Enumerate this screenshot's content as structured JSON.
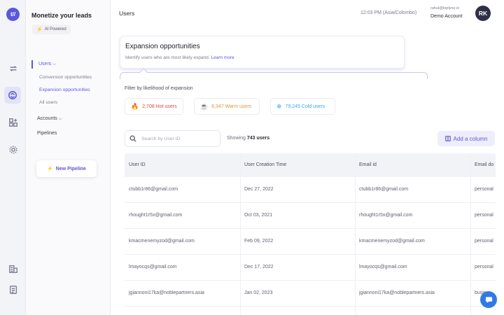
{
  "sidebar": {
    "title": "Monetize your leads",
    "ai_badge": "AI Powered",
    "nav": {
      "users": "Users",
      "conversion": "Conversion opportunities",
      "expansion": "Expansion opportunities",
      "all_users": "All users",
      "accounts": "Accounts",
      "pipelines": "Pipelines"
    },
    "new_pipeline": "New Pipeline"
  },
  "header": {
    "title": "Users",
    "time": "12:03 PM (Asia/Colombo)",
    "account_email": "rahul@toplyne.io",
    "account_name": "Demo Account",
    "avatar_initials": "RK"
  },
  "card": {
    "title": "Expansion opportunities",
    "description": "Identify users who are most likely expand.",
    "learn_more": "Learn more"
  },
  "filters": {
    "label": "Filter by likelihood of expansion",
    "hot": "2,708 Hot users",
    "warm": "6,347 Warm users",
    "cold": "79,245 Cold users"
  },
  "toolbar": {
    "search_placeholder": "Search by User ID",
    "showing_prefix": "Showing",
    "showing_count": "743",
    "showing_suffix": "users",
    "add_column": "Add a column"
  },
  "table": {
    "headers": [
      "User ID",
      "User Creation Time",
      "Email id",
      "Email do"
    ],
    "rows": [
      [
        "ctubb1r86@gmail.com",
        "Dec 27, 2022",
        "ctubb1r86@gmail.com",
        "personal"
      ],
      [
        "rhought1r5x@gmail.com",
        "Oct 03, 2021",
        "rhought1r5x@gmail.com",
        "personal"
      ],
      [
        "kmacmenemyzod@gmail.com",
        "Feb 09, 2022",
        "kmacmenemyzod@gmail.com",
        "personal"
      ],
      [
        "lmayocqs@gmail.com",
        "Dec 17, 2022",
        "lmayocqs@gmail.com",
        "personal"
      ],
      [
        "jgiannoni17ka@noblepartners.asia",
        "Jan 02, 2023",
        "jgiannoni17ka@noblepartners.asia",
        "busin"
      ]
    ]
  },
  "colors": {
    "accent": "#5b57d9",
    "hot": "#e24848",
    "warm": "#e8923a",
    "cold": "#3aa7e8"
  },
  "icons": {
    "rail": [
      "logo-icon",
      "sync-icon",
      "expansion-icon",
      "apps-icon",
      "gear-icon",
      "building-icon",
      "document-icon"
    ],
    "hot": "fire-icon",
    "warm": "coffee-icon",
    "cold": "snowflake-icon"
  }
}
